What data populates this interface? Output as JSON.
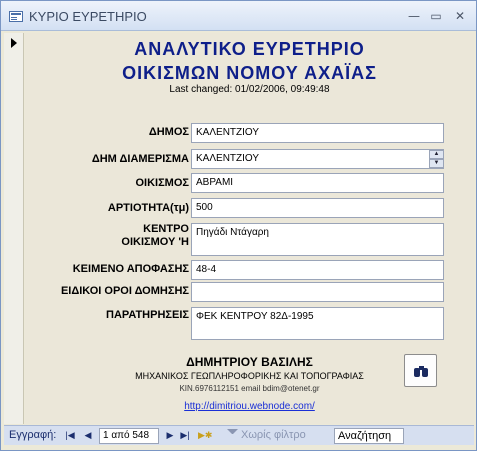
{
  "window": {
    "title": "ΚΥΡΙΟ ΕΥΡΕΤΗΡΙΟ",
    "icon": "form-icon"
  },
  "form": {
    "heading_line1": "ΑΝΑΛΥΤΙΚΟ ΕΥΡΕΤΗΡΙΟ",
    "heading_line2": "ΟΙΚΙΣΜΩΝ ΝΟΜΟΥ ΑΧΑΪΑΣ",
    "last_changed": "Last changed: 01/02/2006, 09:49:48",
    "fields": {
      "dimos": {
        "label": "ΔΗΜΟΣ",
        "value": "ΚΑΛΕΝΤΖΙΟΥ"
      },
      "dim_diamerisma": {
        "label": "ΔΗΜ ΔΙΑΜΕΡΙΣΜΑ",
        "value": "ΚΑΛΕΝΤΖΙΟΥ"
      },
      "oikismos": {
        "label": "ΟΙΚΙΣΜΟΣ",
        "value": "ΑΒΡΑΜΙ"
      },
      "artiotita": {
        "label": "ΑΡΤΙΟΤΗΤΑ(τμ)",
        "value": "500"
      },
      "kentro_line1": "ΚΕΝΤΡΟ",
      "kentro_line2": "ΟΙΚΙΣΜΟΥ 'Η",
      "kentro_value": "Πηγάδι Ντάγαρη",
      "keimeno": {
        "label": "ΚΕΙΜΕΝΟ ΑΠΟΦΑΣΗΣ",
        "value": "48-4"
      },
      "eidikoi": {
        "label": "ΕΙΔΙΚΟΙ ΟΡΟΙ ΔΟΜΗΣΗΣ",
        "value": ""
      },
      "paratiriseis": {
        "label": "ΠΑΡΑΤΗΡΗΣΕΙΣ",
        "value": "ΦΕΚ ΚΕΝΤΡΟΥ 82Δ-1995"
      }
    },
    "author": {
      "name": "ΔΗΜΗΤΡΙΟΥ ΒΑΣΙΛΗΣ",
      "title": "ΜΗΧΑΝΙΚΟΣ ΓΕΩΠΛΗΡΟΦΟΡΙΚΗΣ ΚΑΙ ΤΟΠΟΓΡΑΦΙΑΣ",
      "contact": "ΚΙΝ.6976112151 email bdim@otenet.gr",
      "link": "http://dimitriou.webnode.com/"
    },
    "search_button_icon": "binoculars-icon"
  },
  "navbar": {
    "record_label": "Εγγραφή:",
    "record_position": "1 από 548",
    "filter_label": "Χωρίς φίλτρο",
    "search_label": "Αναζήτηση"
  }
}
